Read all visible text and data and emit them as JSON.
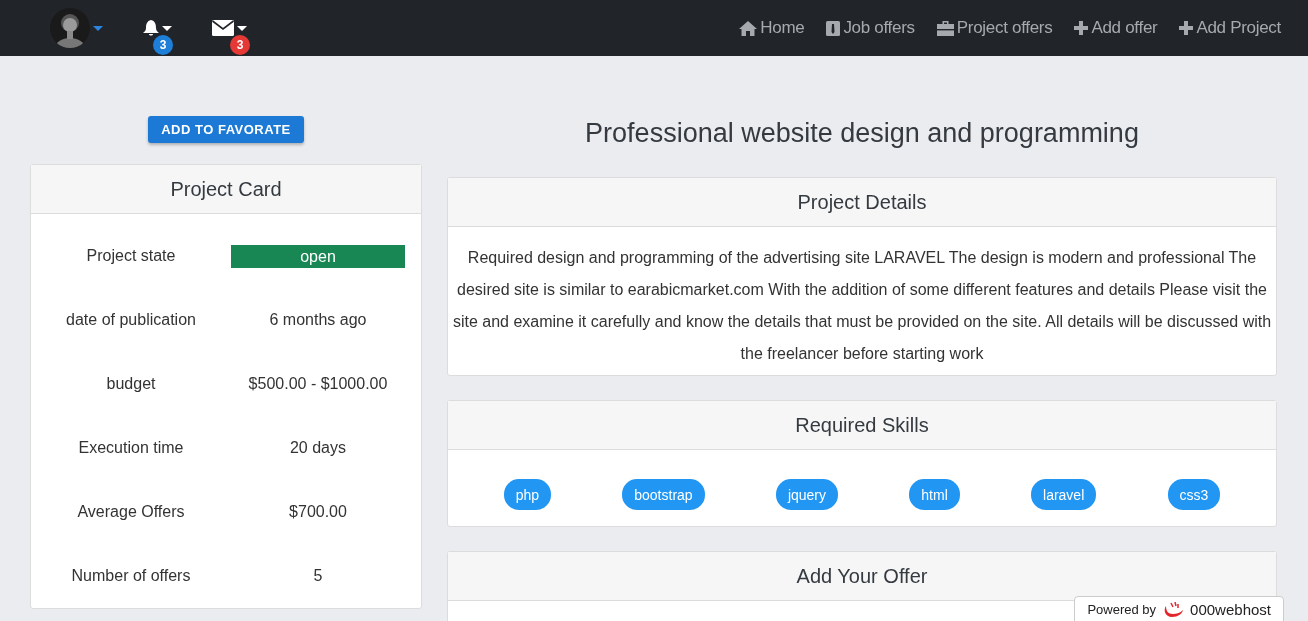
{
  "navbar": {
    "notifications": {
      "badge": "3",
      "color": "#1e7fd8"
    },
    "messages": {
      "badge": "3",
      "color": "#e53935"
    },
    "links": [
      {
        "kind": "home",
        "label": "Home"
      },
      {
        "kind": "job",
        "label": "Job offers"
      },
      {
        "kind": "briefcase",
        "label": "Project offers"
      },
      {
        "kind": "plus",
        "label": "Add offer"
      },
      {
        "kind": "plus",
        "label": "Add Project"
      }
    ]
  },
  "favorite_button": "ADD TO FAVORATE",
  "project_card": {
    "title": "Project Card",
    "rows": [
      {
        "label": "Project state",
        "value": "open",
        "kind": "status"
      },
      {
        "label": "date of publication",
        "value": "6 months ago",
        "kind": "text"
      },
      {
        "label": "budget",
        "value": "$500.00 - $1000.00",
        "kind": "text"
      },
      {
        "label": "Execution time",
        "value": "20 days",
        "kind": "text"
      },
      {
        "label": "Average Offers",
        "value": "$700.00",
        "kind": "text"
      },
      {
        "label": "Number of offers",
        "value": "5",
        "kind": "text"
      }
    ]
  },
  "page_title": "Professional website design and programming",
  "project_details": {
    "title": "Project Details",
    "text": "Required design and programming of the advertising site LARAVEL The design is modern and professional The desired site is similar to earabicmarket.com With the addition of some different features and details Please visit the site and examine it carefully and know the details that must be provided on the site. All details will be discussed with the freelancer before starting work"
  },
  "required_skills": {
    "title": "Required Skills",
    "skills": [
      "php",
      "bootstrap",
      "jquery",
      "html",
      "laravel",
      "css3"
    ]
  },
  "add_offer": {
    "title": "Add Your Offer"
  },
  "hosting_badge": {
    "prefix": "Powered by",
    "brand": "000webhost"
  }
}
